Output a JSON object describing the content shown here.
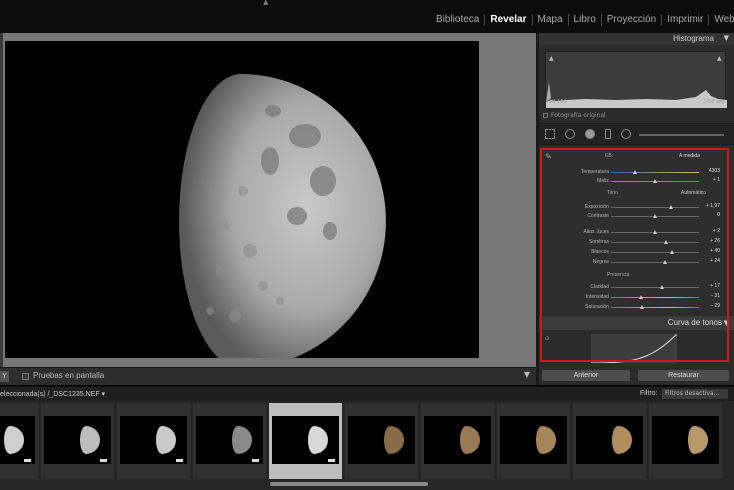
{
  "modules": [
    "Biblioteca",
    "Revelar",
    "Mapa",
    "Libro",
    "Proyección",
    "Imprimir",
    "Web"
  ],
  "active_module": "Revelar",
  "toolbar": {
    "proof_label": "Pruebas en pantalla"
  },
  "histogram": {
    "title": "Histograma",
    "iso": "ISO 100",
    "shutter": "1/50 seg",
    "dash1": "–",
    "dash2": "–",
    "orig_photo": "Fotografía original"
  },
  "basic": {
    "wb_label": "EB:",
    "wb_value": "A medida",
    "tone_label": "Tono",
    "auto_label": "Automático",
    "presence_label": "Presencia",
    "sliders": [
      {
        "label": "Temperatura",
        "value": "4303",
        "pos": 0.28
      },
      {
        "label": "Matiz",
        "value": "+ 1",
        "pos": 0.51
      },
      {
        "label": "Exposición",
        "value": "+ 1,97",
        "pos": 0.69
      },
      {
        "label": "Contraste",
        "value": "0",
        "pos": 0.5
      },
      {
        "label": "Altas. luces",
        "value": "+ 2",
        "pos": 0.51
      },
      {
        "label": "Sombras",
        "value": "+ 26",
        "pos": 0.63
      },
      {
        "label": "Blancos",
        "value": "+ 40",
        "pos": 0.7
      },
      {
        "label": "Negros",
        "value": "+ 24",
        "pos": 0.62
      },
      {
        "label": "Claridad",
        "value": "+ 17",
        "pos": 0.58
      },
      {
        "label": "Intensidad",
        "value": "– 31",
        "pos": 0.35
      },
      {
        "label": "Saturación",
        "value": "– 29",
        "pos": 0.36
      }
    ]
  },
  "curve": {
    "title": "Curva de tonos"
  },
  "buttons": {
    "previous": "Anterior",
    "reset": "Restaurar"
  },
  "film": {
    "selection": "eleccionada(s) /_DSC1235.NEF ▾",
    "filter_label": "Filtro:",
    "filter_value": "Filtros desactiva..."
  },
  "colors": {
    "accent_red": "#d41616",
    "panel": "#2b2b2b"
  },
  "thumbs": [
    {
      "phase": 0.5,
      "tone": "#cfcfcf"
    },
    {
      "phase": 0.45,
      "tone": "#bdbdbd"
    },
    {
      "phase": 0.42,
      "tone": "#c9c9c9"
    },
    {
      "phase": 0.55,
      "tone": "#8a8a8a"
    },
    {
      "phase": 0.5,
      "tone": "#d8d8d8"
    },
    {
      "phase": 0.45,
      "tone": "#8a6b47"
    },
    {
      "phase": 0.45,
      "tone": "#9a7a55"
    },
    {
      "phase": 0.45,
      "tone": "#a68559"
    },
    {
      "phase": 0.45,
      "tone": "#b08e60"
    },
    {
      "phase": 0.45,
      "tone": "#b89868"
    }
  ]
}
